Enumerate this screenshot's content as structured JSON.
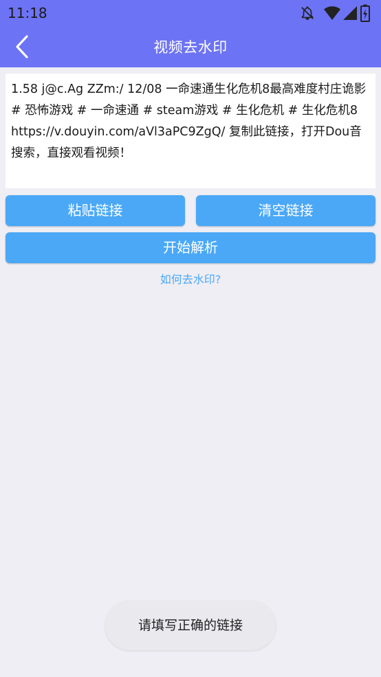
{
  "status_bar": {
    "time": "11:18",
    "icons": [
      "notifications-off-icon",
      "wifi-icon",
      "signal-icon",
      "battery-charging-icon"
    ]
  },
  "app_bar": {
    "back_icon": "chevron-left-icon",
    "title": "视频去水印"
  },
  "link_input": {
    "value": "1.58 j@c.Ag ZZm:/ 12/08 一命速通生化危机8最高难度村庄诡影 # 恐怖游戏 # 一命速通 # steam游戏 # 生化危机 # 生化危机8  https://v.douyin.com/aVl3aPC9ZgQ/ 复制此链接，打开Dou音搜索，直接观看视频！"
  },
  "buttons": {
    "paste": "粘贴链接",
    "clear": "清空链接",
    "parse": "开始解析"
  },
  "help_link": "如何去水印?",
  "toast": "请填写正确的链接",
  "colors": {
    "primary": "#6c73f4",
    "button": "#4aa8f7",
    "background": "#efeef4",
    "link": "#4aa8f7"
  }
}
